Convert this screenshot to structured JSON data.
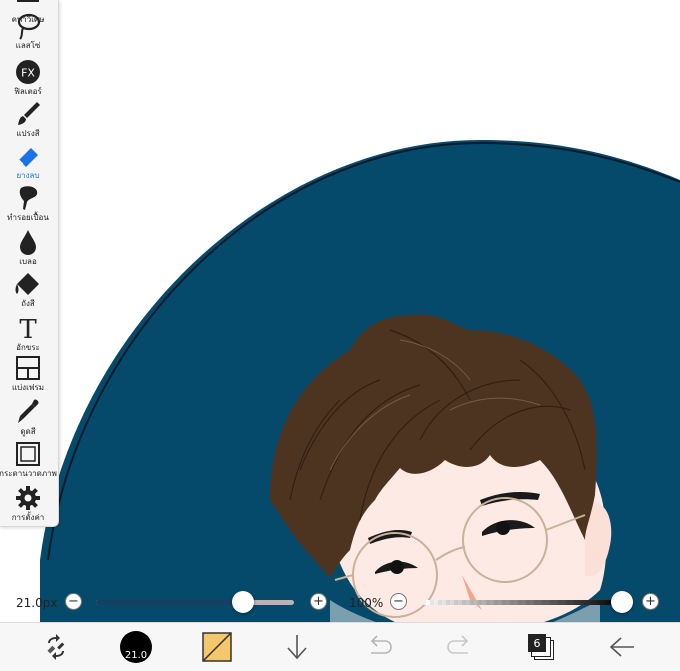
{
  "tools": [
    {
      "id": "special-ruler",
      "label": "คทาวิเศษ",
      "icon": "magic-wand-icon",
      "active": false
    },
    {
      "id": "lasso",
      "label": "แลสโซ่",
      "icon": "lasso-icon",
      "active": false
    },
    {
      "id": "filter",
      "label": "ฟิลเตอร์",
      "icon": "fx-icon",
      "icon_text": "FX",
      "active": false
    },
    {
      "id": "brush",
      "label": "แปรงสี",
      "icon": "brush-icon",
      "active": false
    },
    {
      "id": "eraser",
      "label": "ยางลบ",
      "icon": "eraser-icon",
      "active": true
    },
    {
      "id": "smudge",
      "label": "ทำรอยเปื้อน",
      "icon": "smudge-icon",
      "active": false
    },
    {
      "id": "blur",
      "label": "เบลอ",
      "icon": "blur-drop-icon",
      "active": false
    },
    {
      "id": "bucket",
      "label": "ถังสี",
      "icon": "paint-bucket-icon",
      "active": false
    },
    {
      "id": "text",
      "label": "อักขระ",
      "icon": "text-icon",
      "icon_text": "T",
      "active": false
    },
    {
      "id": "frame",
      "label": "แบ่งเฟรม",
      "icon": "frame-divider-icon",
      "active": false
    },
    {
      "id": "eyedropper",
      "label": "ดูดสี",
      "icon": "eyedropper-icon",
      "active": false
    },
    {
      "id": "canvas",
      "label": "กระดานวาดภาพ",
      "icon": "canvas-icon",
      "active": false
    },
    {
      "id": "settings",
      "label": "การตั้งค่า",
      "icon": "gear-icon",
      "active": false
    }
  ],
  "sliders": {
    "size": {
      "value_text": "21.0px",
      "fraction": 0.74,
      "minus": "−",
      "plus": "+"
    },
    "opacity": {
      "value_text": "100%",
      "fraction": 1.0,
      "minus": "−",
      "plus": "+"
    }
  },
  "bottom": {
    "brush_size_text": "21.0",
    "layer_count": "6"
  },
  "colors": {
    "accent": "#1a73e8",
    "canvas_bg": "#064a6b",
    "size_track": "#163f62",
    "primary_color": "#f3c76a",
    "hair": "#4d3421",
    "skin": "#fdeae4"
  }
}
